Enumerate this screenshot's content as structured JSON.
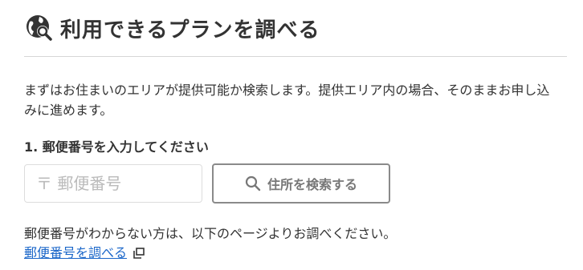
{
  "header": {
    "icon": "map-search-icon",
    "title": "利用できるプランを調べる"
  },
  "description": "まずはお住まいのエリアが提供可能か検索します。提供エリア内の場合、そのままお申し込みに進めます。",
  "step1": {
    "label": "1. 郵便番号を入力してください",
    "zip_input": {
      "value": "",
      "placeholder": "〒 郵便番号"
    },
    "search_button": {
      "label": "住所を検索する",
      "icon": "search-icon"
    }
  },
  "help": {
    "text": "郵便番号がわからない方は、以下のページよりお調べください。",
    "link_label": "郵便番号を調べる",
    "link_icon": "external-link-icon"
  },
  "colors": {
    "text": "#333333",
    "link": "#1a66c9",
    "button_border": "#8a8a8a",
    "divider": "#d6d6d6"
  }
}
